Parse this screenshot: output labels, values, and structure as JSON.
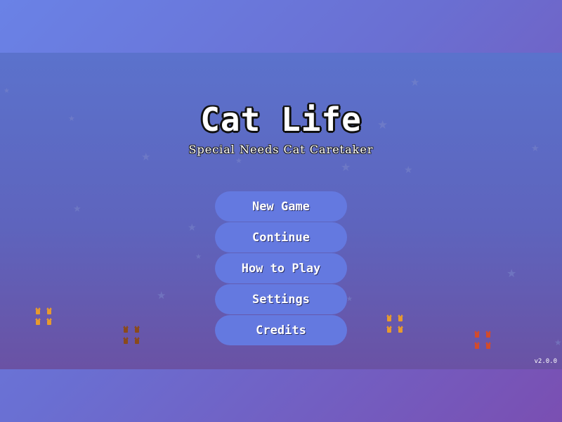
{
  "title": "Cat Life",
  "subtitle": "Special Needs Cat Caretaker",
  "menu": {
    "new_game": "New Game",
    "continue": "Continue",
    "how_to_play": "How to Play",
    "settings": "Settings",
    "credits": "Credits"
  },
  "version": "v2.0.0",
  "colors": {
    "background_accent": "#6a6fd2",
    "button": "#6479e0",
    "cat_orange": "#e79a2e",
    "cat_brown": "#8a4a1c",
    "cat_red": "#d34b2b"
  },
  "icons": {
    "decoration": "star-icon",
    "sprite": "cat-sprite-icon"
  }
}
